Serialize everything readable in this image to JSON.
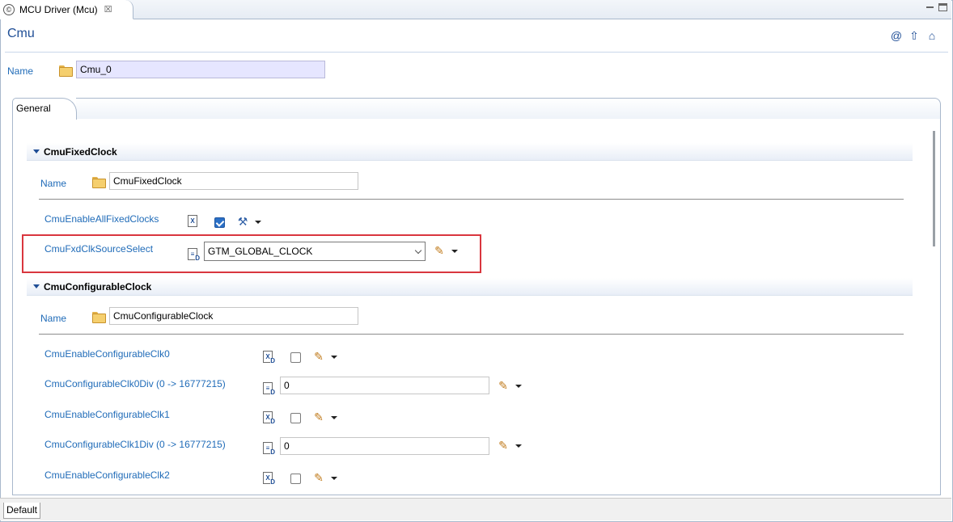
{
  "editor_tab": {
    "title": "MCU Driver (Mcu)",
    "close": "☒"
  },
  "header": {
    "title": "Cmu",
    "icons": [
      "at-icon",
      "up-arrow-icon",
      "home-icon"
    ]
  },
  "top_name": {
    "label": "Name",
    "value": "Cmu_0"
  },
  "tabs": {
    "general": "General",
    "default": "Default"
  },
  "sections": {
    "fixed": {
      "title": "CmuFixedClock",
      "name_label": "Name",
      "name_value": "CmuFixedClock",
      "enable_all_label": "CmuEnableAllFixedClocks",
      "enable_all_checked": true,
      "source_select_label": "CmuFxdClkSourceSelect",
      "source_select_value": "GTM_GLOBAL_CLOCK"
    },
    "configurable": {
      "title": "CmuConfigurableClock",
      "name_label": "Name",
      "name_value": "CmuConfigurableClock",
      "rows": [
        {
          "label": "CmuEnableConfigurableClk0",
          "type": "checkbox",
          "checked": false
        },
        {
          "label": "CmuConfigurableClk0Div (0 -> 16777215)",
          "type": "number",
          "value": "0"
        },
        {
          "label": "CmuEnableConfigurableClk1",
          "type": "checkbox",
          "checked": false
        },
        {
          "label": "CmuConfigurableClk1Div (0 -> 16777215)",
          "type": "number",
          "value": "0"
        },
        {
          "label": "CmuEnableConfigurableClk2",
          "type": "checkbox",
          "checked": false
        }
      ]
    }
  },
  "colors": {
    "label_blue": "#1f6bb8",
    "title_blue": "#1f4e96",
    "highlight_red": "#d9363e"
  }
}
